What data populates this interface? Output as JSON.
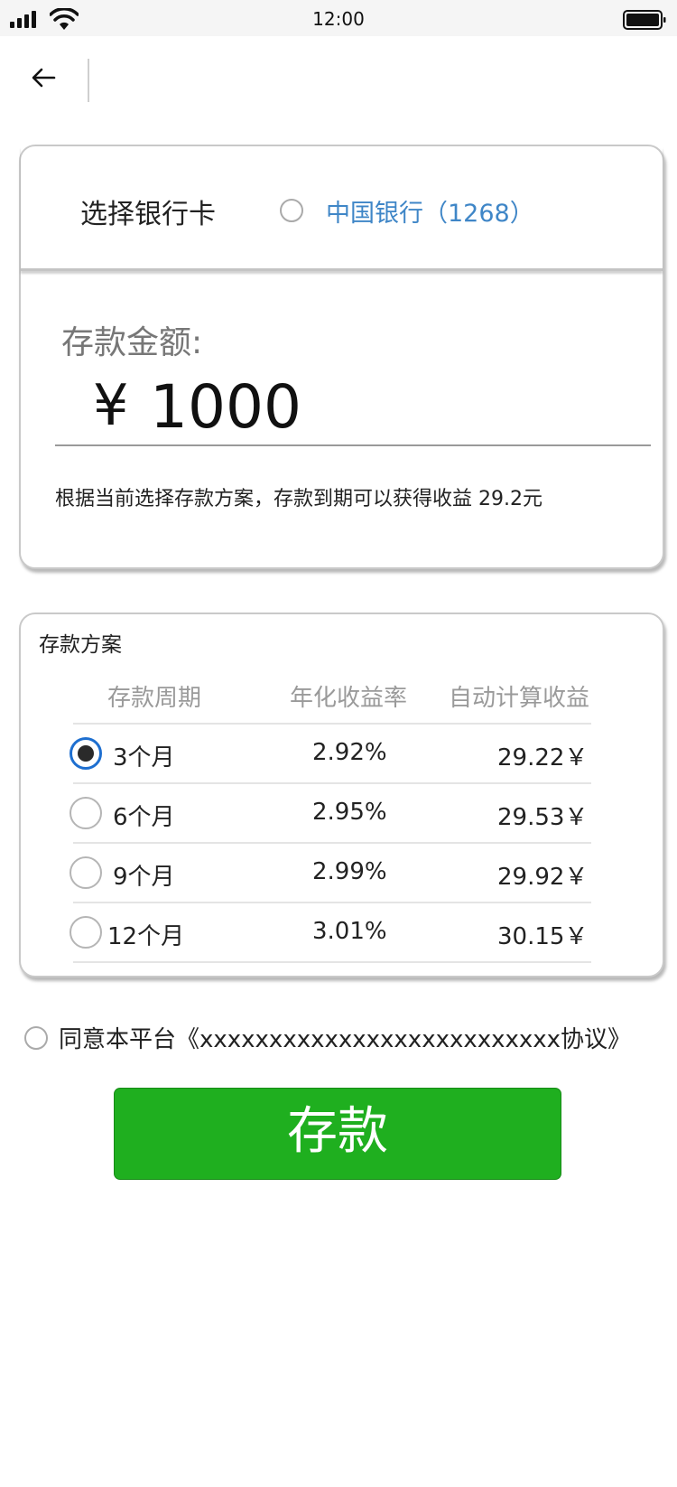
{
  "status_bar": {
    "time": "12:00",
    "icons": [
      "signal-icon",
      "wifi-icon",
      "battery-icon"
    ]
  },
  "nav": {
    "back_icon": "arrow-left-icon"
  },
  "bank_card": {
    "label": "选择银行卡",
    "bank": "中国银行（1268）",
    "selected": false,
    "bank_color": "#3f86c7"
  },
  "deposit": {
    "amount_label": "存款金额:",
    "currency_symbol": "¥",
    "amount": "1000",
    "note": "根据当前选择存款方案，存款到期可以获得收益 29.2元"
  },
  "plan": {
    "title": "存款方案",
    "headers": [
      "存款周期",
      "年化收益率",
      "自动计算收益"
    ],
    "rows": [
      {
        "period": "3个月",
        "rate": "2.92%",
        "earning": "29.22￥",
        "selected": true
      },
      {
        "period": "6个月",
        "rate": "2.95%",
        "earning": "29.53￥",
        "selected": false
      },
      {
        "period": "9个月",
        "rate": "2.99%",
        "earning": "29.92￥",
        "selected": false
      },
      {
        "period": "12个月",
        "rate": "3.01%",
        "earning": "30.15￥",
        "selected": false
      }
    ]
  },
  "agreement": {
    "text": "同意本平台《xxxxxxxxxxxxxxxxxxxxxxxxxx协议》",
    "checked": false
  },
  "actions": {
    "deposit_label": "存款",
    "deposit_color": "#1faf1f"
  }
}
